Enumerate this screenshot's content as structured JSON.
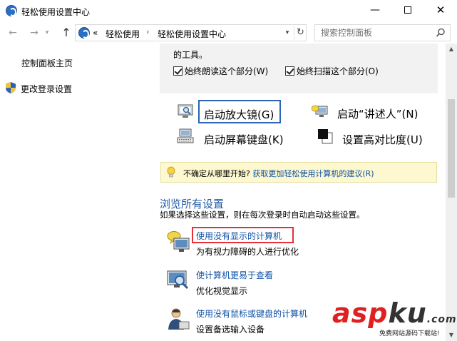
{
  "window": {
    "title": "轻松使用设置中心",
    "controls": {
      "minimize": "—",
      "close": "✕"
    }
  },
  "nav": {
    "back": "←",
    "forward": "→",
    "recent": "▾",
    "up": "↑"
  },
  "address": {
    "overflow": "«",
    "segments": [
      "轻松使用",
      "轻松使用设置中心"
    ],
    "separator": "›",
    "dropdown": "▾",
    "refresh": "↻"
  },
  "search": {
    "placeholder": "搜索控制面板"
  },
  "left_pane": {
    "home": "控制面板主页",
    "login_settings": "更改登录设置"
  },
  "panel": {
    "truncated_text": "的工具。",
    "checkboxes": [
      {
        "label": "始终朗读这个部分(W)",
        "checked": true
      },
      {
        "label": "始终扫描这个部分(O)",
        "checked": true
      }
    ],
    "tools": {
      "magnifier": "启动放大镜(G)",
      "narrator": "启动“讲述人”(N)",
      "keyboard": "启动屏幕键盘(K)",
      "contrast": "设置高对比度(U)"
    }
  },
  "tip": {
    "prefix": "不确定从哪里开始?",
    "link": "获取更加轻松使用计算机的建议(R)"
  },
  "browse": {
    "title": "浏览所有设置",
    "desc": "如果选择这些设置，则在每次登录时自动启动这些设置。",
    "items": [
      {
        "link": "使用没有显示的计算机",
        "desc": "为有视力障碍的人进行优化",
        "icon": "monitor-speech-icon"
      },
      {
        "link": "使计算机更易于查看",
        "desc": "优化视觉显示",
        "icon": "monitor-magnifier-icon"
      },
      {
        "link": "使用没有鼠标或键盘的计算机",
        "desc": "设置备选输入设备",
        "icon": "person-icon"
      }
    ]
  },
  "scrollbar": {
    "up": "▲",
    "down": "▼"
  },
  "watermark": {
    "main_a": "asp",
    "main_b": "ku",
    "tld": ".com",
    "sub": "免费网站源码下载站!"
  },
  "colors": {
    "link": "#0d51a6",
    "section_title": "#1e5aa8",
    "focus_border": "#2a66b1",
    "highlight": "#e5303a",
    "tip_bg": "#fdf8cf",
    "panel_bg": "#f2f2f2"
  }
}
